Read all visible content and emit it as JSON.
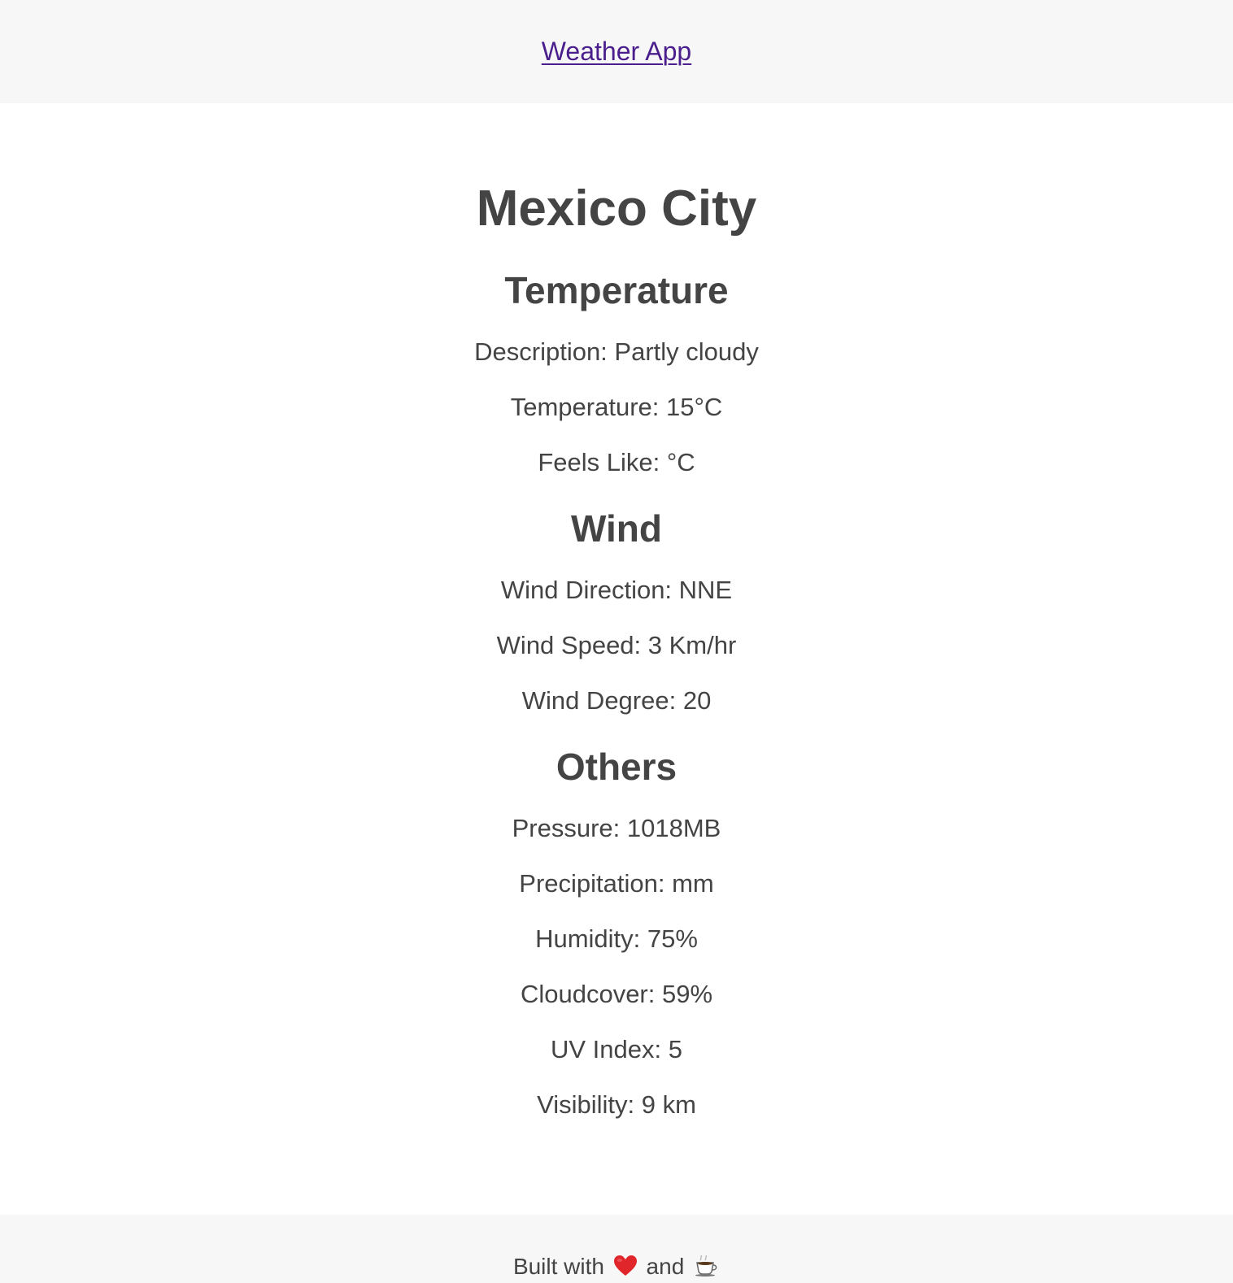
{
  "header": {
    "app_link": "Weather App"
  },
  "main": {
    "city": "Mexico City",
    "temperature": {
      "heading": "Temperature",
      "description": "Description: Partly cloudy",
      "temperature": "Temperature: 15°C",
      "feels_like": "Feels Like: °C"
    },
    "wind": {
      "heading": "Wind",
      "direction": "Wind Direction: NNE",
      "speed": "Wind Speed: 3 Km/hr",
      "degree": "Wind Degree: 20"
    },
    "others": {
      "heading": "Others",
      "pressure": "Pressure: 1018MB",
      "precipitation": "Precipitation: mm",
      "humidity": "Humidity: 75%",
      "cloudcover": "Cloudcover: 59%",
      "uv_index": "UV Index: 5",
      "visibility": "Visibility: 9 km"
    }
  },
  "footer": {
    "built_with": "Built with",
    "and": "and",
    "icons": [
      "heart-icon",
      "coffee-icon"
    ]
  },
  "colors": {
    "link": "#4a1e8c",
    "text": "#444444",
    "band_bg": "#f7f7f7",
    "heart": "#e0262b"
  }
}
